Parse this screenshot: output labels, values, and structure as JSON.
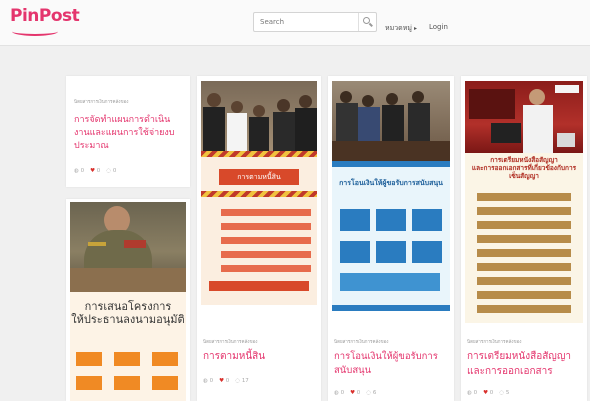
{
  "header": {
    "logo_text": "PinPost",
    "search_placeholder": "Search",
    "category_menu": "หมวดหมู่",
    "login": "Login"
  },
  "cards": [
    {
      "category": "นิตยสารการเงินการคลังของ",
      "title": "การจัดทำแผนการดำเนินงานและแผนการใช้จ่ายงบประมาณ",
      "stats": [
        "0",
        "0",
        "0"
      ]
    },
    {
      "category": "",
      "title": "",
      "slide_title": "การเสนอโครงการ\nให้ประธานลงนามอนุมัติ",
      "stats": []
    },
    {
      "category": "นิตยสารการเงินการคลังของ",
      "title": "การตามหนี้สิน",
      "slide_title": "การตามหนี้สิน",
      "stats": [
        "0",
        "0",
        "17"
      ]
    },
    {
      "category": "นิตยสารการเงินการคลังของ",
      "title": "การโอนเงินให้ผู้ขอรับการสนับสนุน",
      "slide_title": "การโอนเงินให้ผู้ขอรับการสนับสนุน",
      "stats": [
        "0",
        "0",
        "6"
      ]
    },
    {
      "category": "นิตยสารการเงินการคลังของ",
      "title": "การเตรียมหนังสือสัญญาและการออกเอกสาร",
      "slide_title": "การเตรียมหนังสือสัญญา\nและการออกเอกสารที่เกี่ยวข้องกับการเซ็นสัญญา",
      "stats": [
        "0",
        "0",
        "5"
      ]
    }
  ],
  "colors": {
    "accent": "#e4356d",
    "heart": "#d9302c",
    "slide_orange": "#f08a24",
    "slide_blue": "#2a7cc0",
    "slide_brown": "#9b6b3a"
  },
  "icons": [
    "search-icon",
    "heart-icon",
    "view-icon",
    "comment-icon",
    "chevron-down-icon"
  ]
}
